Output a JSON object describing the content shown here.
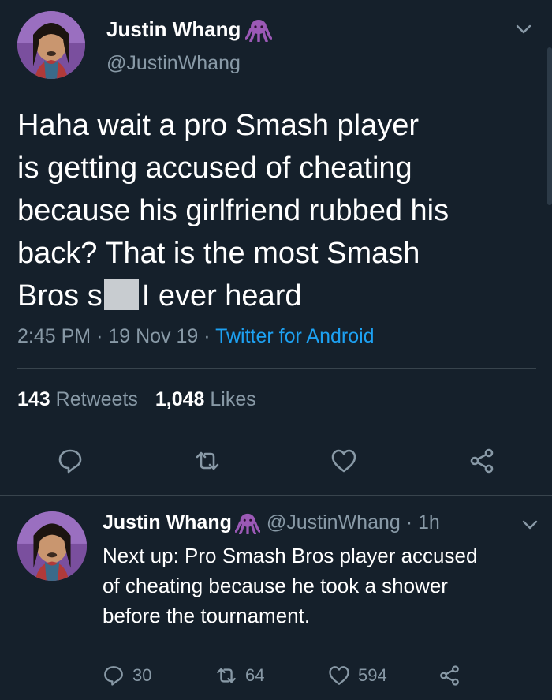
{
  "main_tweet": {
    "display_name": "Justin Whang",
    "handle": "@JustinWhang",
    "text_lines": [
      "Haha wait a pro Smash player",
      "is getting accused of cheating",
      "because his girlfriend rubbed his",
      "back? That is the most Smash"
    ],
    "last_line_before": "Bros s",
    "last_line_after": "I ever heard",
    "time": "2:45 PM",
    "date": "19 Nov 19",
    "source": "Twitter for Android",
    "retweets_count": "143",
    "retweets_label": "Retweets",
    "likes_count": "1,048",
    "likes_label": "Likes"
  },
  "reply_tweet": {
    "display_name": "Justin Whang",
    "handle": "@JustinWhang",
    "age": "1h",
    "text_lines": [
      "Next up: Pro Smash Bros player accused",
      "of cheating because he took a shower",
      "before the tournament."
    ],
    "replies": "30",
    "retweets": "64",
    "likes": "594"
  },
  "colors": {
    "background": "#15202b",
    "secondary_text": "#8899a6",
    "link": "#1da1f2",
    "badge": "#9b59b6"
  },
  "icons": [
    "octopus-emoji-icon",
    "chevron-down-icon",
    "reply-icon",
    "retweet-icon",
    "like-icon",
    "share-icon"
  ]
}
